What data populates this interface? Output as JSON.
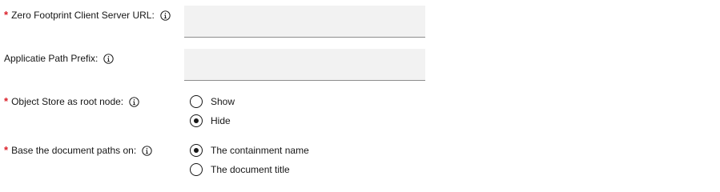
{
  "fields": {
    "client_url": {
      "label": "Zero Footprint Client Server URL:",
      "required_mark": "*",
      "value": ""
    },
    "path_prefix": {
      "label": "Applicatie Path Prefix:",
      "value": ""
    },
    "object_store_root": {
      "label": "Object Store as root node:",
      "required_mark": "*",
      "options": [
        {
          "label": "Show",
          "checked": false
        },
        {
          "label": "Hide",
          "checked": true
        }
      ]
    },
    "document_paths": {
      "label": "Base the document paths on:",
      "required_mark": "*",
      "options": [
        {
          "label": "The containment name",
          "checked": true
        },
        {
          "label": "The document title",
          "checked": false
        }
      ]
    }
  },
  "icons": {
    "info": "info-icon"
  },
  "colors": {
    "required": "#da1e28",
    "input_bg": "#f2f2f2",
    "input_border": "#8d8d8d",
    "text": "#161616"
  }
}
